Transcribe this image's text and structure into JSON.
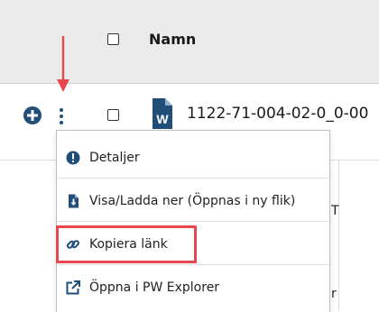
{
  "table": {
    "header_name": "Namn",
    "file_name": "1122-71-004-02-0_0-00"
  },
  "icons": {
    "add": "plus-circle-icon",
    "more": "vertical-ellipsis-icon",
    "file": "word-document-icon",
    "arrow": "red-down-arrow-icon",
    "file_badge": "W"
  },
  "context_menu": {
    "items": [
      {
        "label": "Detaljer",
        "icon": "info-circle-icon"
      },
      {
        "label": "Visa/Ladda ner (Öppnas i ny flik)",
        "icon": "file-download-icon"
      },
      {
        "label": "Kopiera länk",
        "icon": "link-icon",
        "highlighted": true
      },
      {
        "label": "Öppna i PW Explorer",
        "icon": "external-link-icon"
      }
    ]
  },
  "background_fragments": {
    "row_peek_1": "T",
    "row_peek_2": "r"
  },
  "colors": {
    "header_bg": "#ebebeb",
    "accent_blue": "#1f4e79",
    "highlight_red": "#e8474d",
    "arrow_red": "#e8474d"
  }
}
